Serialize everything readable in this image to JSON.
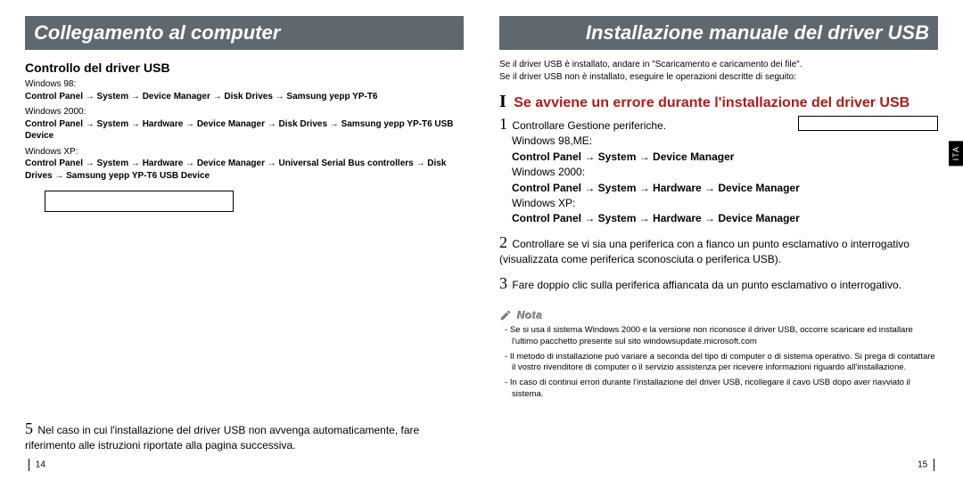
{
  "left": {
    "title": "Collegamento al computer",
    "section_heading": "Controllo del driver USB",
    "win98_label": "Windows 98: ",
    "win98_path": "Control Panel → System → Device Manager → Disk Drives → Samsung yepp YP-T6",
    "win2000_label": "Windows 2000: ",
    "win2000_path": "Control Panel → System → Hardware → Device Manager → Disk Drives → Samsung yepp YP-T6  USB Device",
    "winxp_label": "Windows XP: ",
    "winxp_path": "Control Panel → System → Hardware → Device Manager → Universal Serial Bus controllers → Disk Drives → Samsung yepp YP-T6  USB Device",
    "step5_num": "5",
    "step5_text": "Nel caso in cui l'installazione del driver USB non avvenga automaticamente, fare riferimento alle istruzioni riportate alla pagina successiva.",
    "page_num": "14"
  },
  "right": {
    "title": "Installazione manuale del driver USB",
    "lang_tab": "ITA",
    "top_note_1": "Se il driver USB è installato, andare in \"Scaricamento e caricamento dei file\".",
    "top_note_2": "Se il driver USB non è installato, eseguire le operazioni descritte di seguito:",
    "red_heading": "Se avviene un errore durante l'installazione del driver USB",
    "s1_num": "1",
    "s1_text": "Controllare Gestione periferiche.",
    "s1_win98": "Windows 98,ME:",
    "s1_win98_path": "Control Panel → System → Device Manager",
    "s1_win2000": "Windows 2000:",
    "s1_win2000_path": "Control Panel → System → Hardware → Device Manager",
    "s1_winxp": "Windows XP:",
    "s1_winxp_path": "Control Panel → System → Hardware → Device Manager",
    "s2_num": "2",
    "s2_text": "Controllare se vi sia una periferica con a fianco un punto esclamativo o interrogativo (visualizzata come periferica sconosciuta o periferica USB).",
    "s3_num": "3",
    "s3_text": "Fare doppio clic sulla periferica affiancata da un punto esclamativo o interrogativo.",
    "note_label": "Nota",
    "note_1": "Se si usa il sistema Windows 2000 e la versione non riconosce il driver USB, occorre scaricare ed installare l'ultimo pacchetto presente sul sito windowsupdate.microsoft.com",
    "note_2": "Il metodo di installazione può variare a seconda del tipo di computer o di sistema operativo. Si prega di contattare il vostro rivenditore di computer o il servizio assistenza per ricevere informazioni riguardo all'installazione.",
    "note_3": "In caso di continui errori durante l'installazione del driver USB, ricollegare il cavo USB dopo aver riavviato il sistema.",
    "page_num": "15"
  }
}
